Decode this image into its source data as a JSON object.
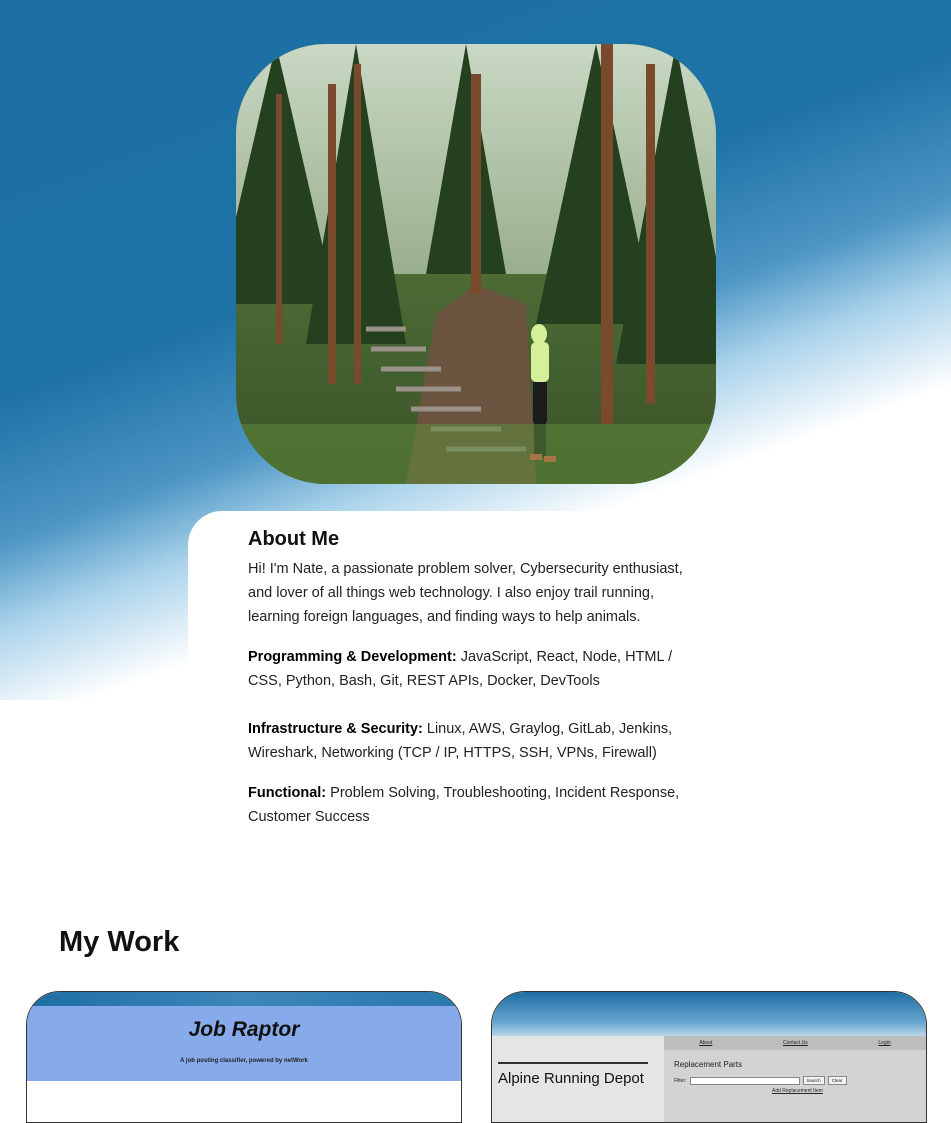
{
  "about": {
    "heading": "About Me",
    "intro": "Hi! I'm Nate, a passionate problem solver, Cybersecurity enthusiast, and lover of all things web technology. I also enjoy trail running, learning foreign languages, and finding ways to help animals.",
    "skills": [
      {
        "label": "Programming & Development:",
        "text": " JavaScript, React, Node, HTML / CSS, Python, Bash, Git, REST APIs, Docker, DevTools"
      },
      {
        "label": "Infrastructure & Security:",
        "text": " Linux, AWS, Graylog, GitLab, Jenkins, Wireshark, Networking (TCP / IP, HTTPS, SSH, VPNs, Firewall)"
      },
      {
        "label": "Functional:",
        "text": " Problem Solving, Troubleshooting, Incident Response, Customer Success"
      }
    ]
  },
  "work": {
    "title": "My Work",
    "projects": [
      {
        "title": "Job Raptor",
        "subtitle": "A job posting classifier, powered by netWork"
      },
      {
        "title": "Alpine Running Depot",
        "nav": [
          "About",
          "Contact Us",
          "Login"
        ],
        "heading": "Replacement Parts",
        "filter_label": "Filter:",
        "buttons": [
          "Search",
          "Clear"
        ],
        "add_link": "Add Replacement Item"
      }
    ]
  },
  "colors": {
    "accent": "#1d72a6",
    "job_raptor_banner": "#87aaea"
  }
}
